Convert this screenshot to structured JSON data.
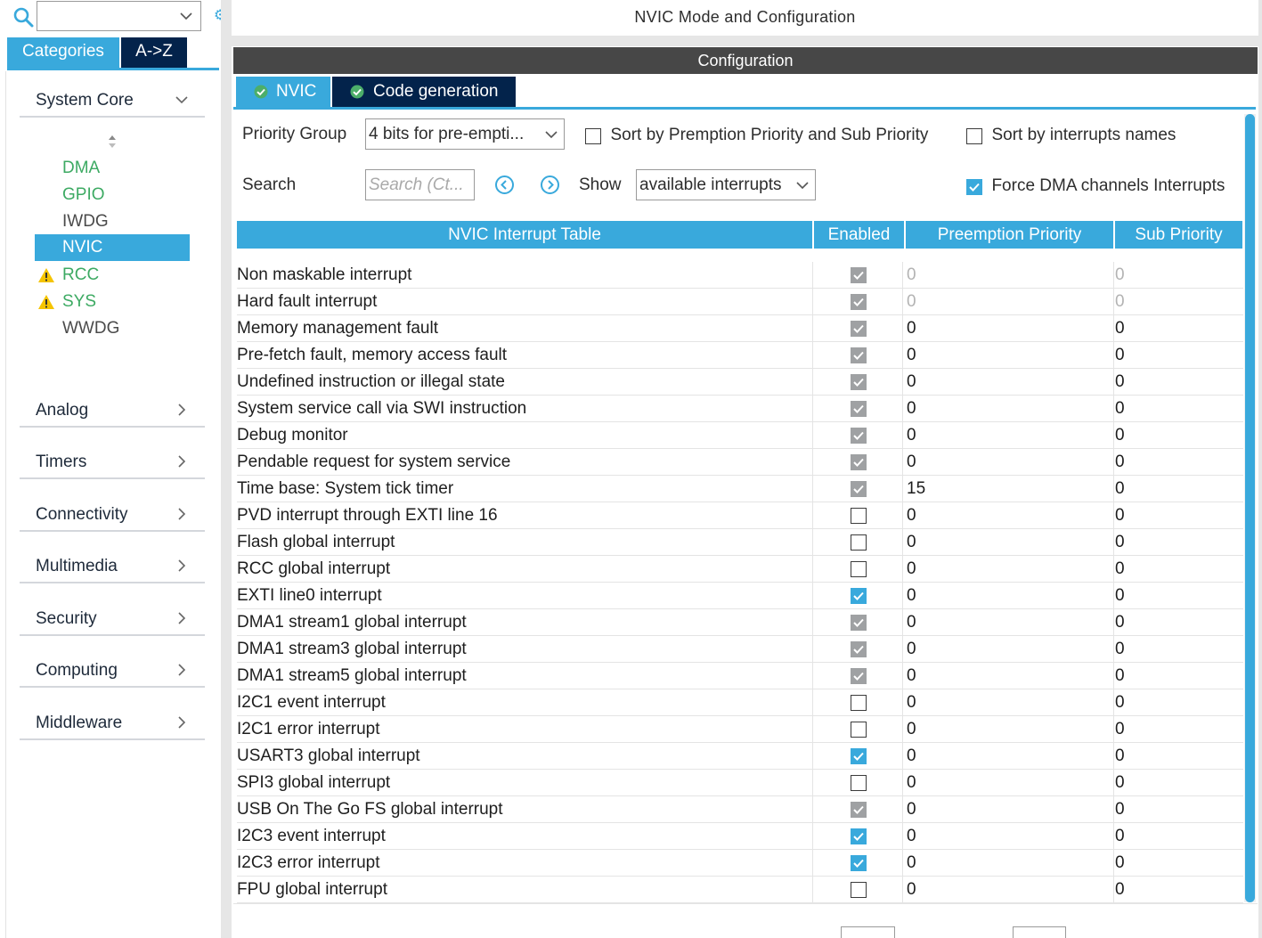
{
  "sidebar": {
    "search": {
      "value": ""
    },
    "tabs": {
      "categories": "Categories",
      "az": "A->Z"
    },
    "system_core": {
      "label": "System Core",
      "items": [
        {
          "label": "DMA",
          "warning": false,
          "selected": false,
          "style": "configured"
        },
        {
          "label": "GPIO",
          "warning": false,
          "selected": false,
          "style": "configured"
        },
        {
          "label": "IWDG",
          "warning": false,
          "selected": false,
          "style": "default"
        },
        {
          "label": "NVIC",
          "warning": false,
          "selected": true,
          "style": "default"
        },
        {
          "label": "RCC",
          "warning": true,
          "selected": false,
          "style": "configured"
        },
        {
          "label": "SYS",
          "warning": true,
          "selected": false,
          "style": "configured"
        },
        {
          "label": "WWDG",
          "warning": false,
          "selected": false,
          "style": "default"
        }
      ]
    },
    "groups": [
      "Analog",
      "Timers",
      "Connectivity",
      "Multimedia",
      "Security",
      "Computing",
      "Middleware"
    ]
  },
  "main": {
    "title": "NVIC Mode and Configuration",
    "config_label": "Configuration",
    "tabs": {
      "nvic": "NVIC",
      "code_gen": "Code generation"
    },
    "priority_group_label": "Priority Group",
    "priority_group_value": "4 bits for pre-empti...",
    "sort_preemption_label": "Sort by Premption Priority and Sub Priority",
    "sort_preemption_checked": false,
    "sort_names_label": "Sort by interrupts names",
    "sort_names_checked": false,
    "search_label": "Search",
    "search_placeholder": "Search (Ct...",
    "show_label": "Show",
    "show_value": "available interrupts",
    "force_dma_label": "Force DMA channels Interrupts",
    "force_dma_checked": true
  },
  "table": {
    "headers": [
      "NVIC Interrupt Table",
      "Enabled",
      "Preemption Priority",
      "Sub Priority"
    ],
    "rows": [
      {
        "name": "Non maskable interrupt",
        "enabled": "locked",
        "preemption": "0",
        "sub": "0",
        "editable": false
      },
      {
        "name": "Hard fault interrupt",
        "enabled": "locked",
        "preemption": "0",
        "sub": "0",
        "editable": false
      },
      {
        "name": "Memory management fault",
        "enabled": "locked",
        "preemption": "0",
        "sub": "0",
        "editable": true
      },
      {
        "name": "Pre-fetch fault, memory access fault",
        "enabled": "locked",
        "preemption": "0",
        "sub": "0",
        "editable": true
      },
      {
        "name": "Undefined instruction or illegal state",
        "enabled": "locked",
        "preemption": "0",
        "sub": "0",
        "editable": true
      },
      {
        "name": "System service call via SWI instruction",
        "enabled": "locked",
        "preemption": "0",
        "sub": "0",
        "editable": true
      },
      {
        "name": "Debug monitor",
        "enabled": "locked",
        "preemption": "0",
        "sub": "0",
        "editable": true
      },
      {
        "name": "Pendable request for system service",
        "enabled": "locked",
        "preemption": "0",
        "sub": "0",
        "editable": true
      },
      {
        "name": "Time base: System tick timer",
        "enabled": "locked",
        "preemption": "15",
        "sub": "0",
        "editable": true
      },
      {
        "name": "PVD interrupt through EXTI line 16",
        "enabled": "off",
        "preemption": "0",
        "sub": "0",
        "editable": true
      },
      {
        "name": "Flash global interrupt",
        "enabled": "off",
        "preemption": "0",
        "sub": "0",
        "editable": true
      },
      {
        "name": "RCC global interrupt",
        "enabled": "off",
        "preemption": "0",
        "sub": "0",
        "editable": true
      },
      {
        "name": "EXTI line0 interrupt",
        "enabled": "on",
        "preemption": "0",
        "sub": "0",
        "editable": true
      },
      {
        "name": "DMA1 stream1 global interrupt",
        "enabled": "locked",
        "preemption": "0",
        "sub": "0",
        "editable": true
      },
      {
        "name": "DMA1 stream3 global interrupt",
        "enabled": "locked",
        "preemption": "0",
        "sub": "0",
        "editable": true
      },
      {
        "name": "DMA1 stream5 global interrupt",
        "enabled": "locked",
        "preemption": "0",
        "sub": "0",
        "editable": true
      },
      {
        "name": "I2C1 event interrupt",
        "enabled": "off",
        "preemption": "0",
        "sub": "0",
        "editable": true
      },
      {
        "name": "I2C1 error interrupt",
        "enabled": "off",
        "preemption": "0",
        "sub": "0",
        "editable": true
      },
      {
        "name": "USART3 global interrupt",
        "enabled": "on",
        "preemption": "0",
        "sub": "0",
        "editable": true
      },
      {
        "name": "SPI3 global interrupt",
        "enabled": "off",
        "preemption": "0",
        "sub": "0",
        "editable": true
      },
      {
        "name": "USB On The Go FS global interrupt",
        "enabled": "locked",
        "preemption": "0",
        "sub": "0",
        "editable": true
      },
      {
        "name": "I2C3 event interrupt",
        "enabled": "on",
        "preemption": "0",
        "sub": "0",
        "editable": true
      },
      {
        "name": "I2C3 error interrupt",
        "enabled": "on",
        "preemption": "0",
        "sub": "0",
        "editable": true
      },
      {
        "name": "FPU global interrupt",
        "enabled": "off",
        "preemption": "0",
        "sub": "0",
        "editable": true
      }
    ]
  },
  "colors": {
    "accent": "#39a9dc",
    "navy": "#03234b",
    "configured_green": "#3daa63",
    "config_bar": "#474747",
    "warning": "#f5c400"
  }
}
